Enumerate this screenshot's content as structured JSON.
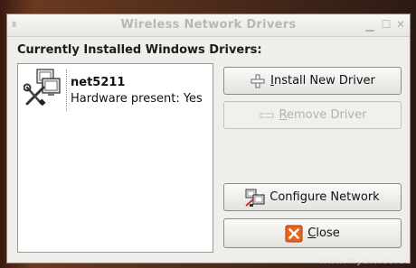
{
  "window": {
    "title": "Wireless Network Drivers"
  },
  "heading": "Currently Installed Windows Drivers:",
  "drivers": [
    {
      "name": "net5211",
      "status": "Hardware present: Yes",
      "icon": "driver-tools-icon"
    }
  ],
  "buttons": {
    "install": {
      "prefix": "",
      "mnemonic": "I",
      "rest": "nstall New Driver",
      "icon": "plus-icon"
    },
    "remove": {
      "prefix": "",
      "mnemonic": "R",
      "rest": "emove Driver",
      "icon": "minus-icon",
      "enabled": false
    },
    "configure": {
      "label": "Configure Network",
      "icon": "network-config-icon"
    },
    "close": {
      "prefix": "",
      "mnemonic": "C",
      "rest": "lose",
      "icon": "close-icon"
    }
  },
  "watermark": "www.mydiv.co.uu",
  "colors": {
    "close_icon": "#e8641c",
    "window_bg": "#efeeeb"
  }
}
